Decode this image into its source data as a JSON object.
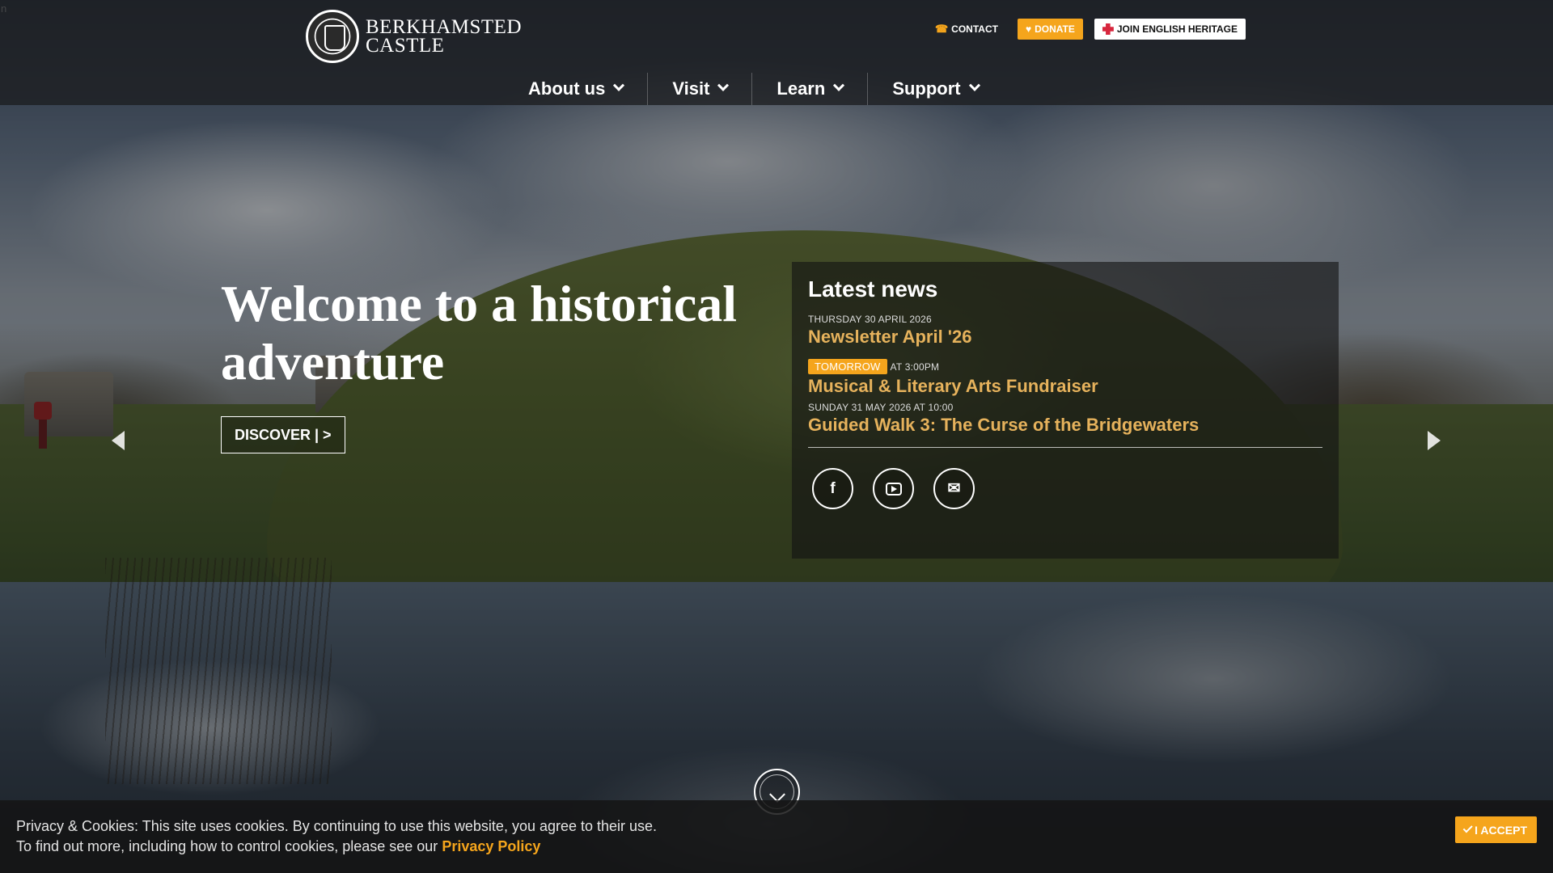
{
  "header": {
    "logo_text_line1": "BERKHAMSTED",
    "logo_text_line2": "CASTLE",
    "contact_label": "CONTACT",
    "donate_label": "DONATE",
    "join_label": "JOIN ENGLISH HERITAGE"
  },
  "nav": {
    "items": [
      {
        "label": "About us"
      },
      {
        "label": "Visit"
      },
      {
        "label": "Learn"
      },
      {
        "label": "Support"
      }
    ]
  },
  "hero": {
    "title": "Welcome to a historical adventure",
    "cta_label": "DISCOVER | >"
  },
  "news": {
    "title": "Latest news",
    "items": [
      {
        "date": "THURSDAY 30 APRIL 2026",
        "title": "Newsletter April '26"
      },
      {
        "badge": "TOMORROW",
        "date": "AT 3:00PM",
        "title": "Musical & Literary Arts Fundraiser"
      },
      {
        "date": "SUNDAY 31 MAY 2026 AT 10:00",
        "title": "Guided Walk 3: The Curse of the Bridgewaters"
      }
    ],
    "socials": [
      {
        "icon": "facebook-icon",
        "glyph": "f"
      },
      {
        "icon": "youtube-icon"
      },
      {
        "icon": "email-icon",
        "glyph": "✉"
      }
    ]
  },
  "cookie": {
    "line1": "Privacy & Cookies: This site uses cookies. By continuing to use this website, you agree to their use.",
    "line2": "To find out more, including how to control cookies, please see our",
    "link": "Privacy Policy",
    "accept_label": "I ACCEPT"
  },
  "misc": {
    "corner_glyph": "n"
  },
  "colors": {
    "accent": "#f5a51c",
    "link_gold": "#e6b25c",
    "eh_red": "#d7263d"
  }
}
